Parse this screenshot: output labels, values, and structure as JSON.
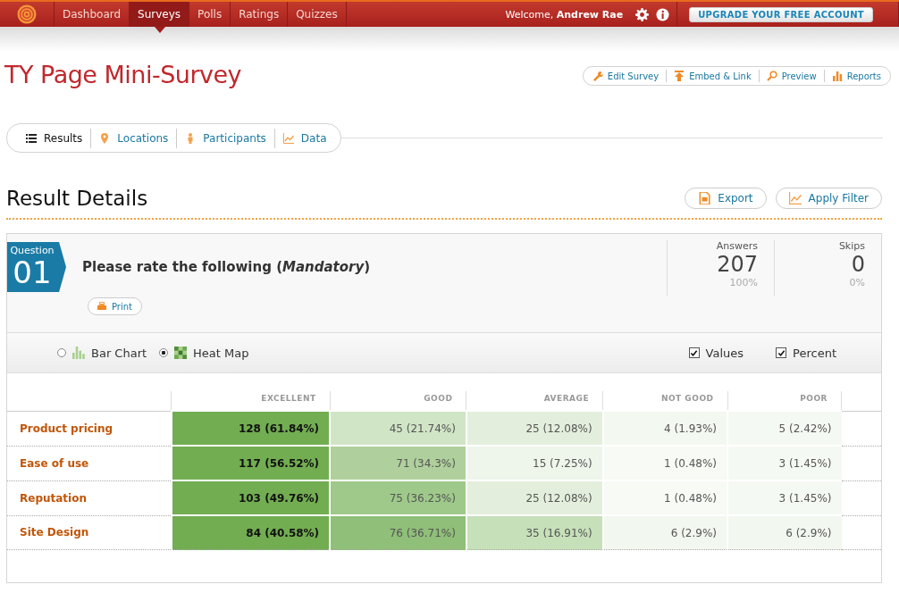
{
  "topbar": {
    "nav": [
      {
        "label": "Dashboard",
        "selected": false
      },
      {
        "label": "Surveys",
        "selected": true
      },
      {
        "label": "Polls",
        "selected": false
      },
      {
        "label": "Ratings",
        "selected": false
      },
      {
        "label": "Quizzes",
        "selected": false
      }
    ],
    "welcome": "Welcome,",
    "user": "Andrew Rae",
    "upgrade": "UPGRADE YOUR FREE ACCOUNT"
  },
  "title": "TY Page Mini-Survey",
  "actions": [
    {
      "label": "Edit Survey",
      "kind": "wrench"
    },
    {
      "label": "Embed & Link",
      "kind": "upload"
    },
    {
      "label": "Preview",
      "kind": "search"
    },
    {
      "label": "Reports",
      "kind": "bars"
    }
  ],
  "tabs": [
    {
      "label": "Results",
      "kind": "list",
      "selected": true
    },
    {
      "label": "Locations",
      "kind": "pin",
      "selected": false
    },
    {
      "label": "Participants",
      "kind": "person",
      "selected": false
    },
    {
      "label": "Data",
      "kind": "chart",
      "selected": false
    }
  ],
  "section": {
    "title": "Result Details",
    "buttons": [
      {
        "label": "Export",
        "kind": "export"
      },
      {
        "label": "Apply Filter",
        "kind": "chart"
      }
    ]
  },
  "question": {
    "tag": "Question",
    "number": "01",
    "text": "Please rate the following (*Mandatory*)",
    "print": "Print",
    "stats": [
      {
        "label": "Answers",
        "value": "207",
        "percent": "100%"
      },
      {
        "label": "Skips",
        "value": "0",
        "percent": "0%"
      }
    ]
  },
  "view": {
    "modes": [
      {
        "label": "Bar Chart",
        "kind": "bars",
        "selected": false
      },
      {
        "label": "Heat Map",
        "kind": "heat",
        "selected": true
      }
    ],
    "options": [
      {
        "label": "Values",
        "checked": true
      },
      {
        "label": "Percent",
        "checked": true
      }
    ]
  },
  "table": {
    "columns": [
      "EXCELLENT",
      "GOOD",
      "AVERAGE",
      "NOT GOOD",
      "POOR"
    ],
    "rows": [
      {
        "label": "Product pricing",
        "cells": [
          {
            "text": "128 (61.84%)",
            "color": "#72ad52"
          },
          {
            "text": "45 (21.74%)",
            "color": "#d0e5c6"
          },
          {
            "text": "25 (12.08%)",
            "color": "#e3efdc"
          },
          {
            "text": "4 (1.93%)",
            "color": "#f3f8f0"
          },
          {
            "text": "5 (2.42%)",
            "color": "#f5f9f3"
          }
        ]
      },
      {
        "label": "Ease of use",
        "cells": [
          {
            "text": "117 (56.52%)",
            "color": "#72ad52"
          },
          {
            "text": "71 (34.3%)",
            "color": "#afd09c"
          },
          {
            "text": "15 (7.25%)",
            "color": "#eef5ea"
          },
          {
            "text": "1 (0.48%)",
            "color": "#f7faf5"
          },
          {
            "text": "3 (1.45%)",
            "color": "#f5f9f3"
          }
        ]
      },
      {
        "label": "Reputation",
        "cells": [
          {
            "text": "103 (49.76%)",
            "color": "#72ad52"
          },
          {
            "text": "75 (36.23%)",
            "color": "#9ec98a"
          },
          {
            "text": "25 (12.08%)",
            "color": "#e3efdc"
          },
          {
            "text": "1 (0.48%)",
            "color": "#f7faf5"
          },
          {
            "text": "3 (1.45%)",
            "color": "#f5f9f3"
          }
        ]
      },
      {
        "label": "Site Design",
        "cells": [
          {
            "text": "84 (40.58%)",
            "color": "#72ad52"
          },
          {
            "text": "76 (36.71%)",
            "color": "#8fbf78"
          },
          {
            "text": "35 (16.91%)",
            "color": "#c6e0b9"
          },
          {
            "text": "6 (2.9%)",
            "color": "#f2f7ef"
          },
          {
            "text": "6 (2.9%)",
            "color": "#f2f7ef"
          }
        ]
      }
    ]
  }
}
